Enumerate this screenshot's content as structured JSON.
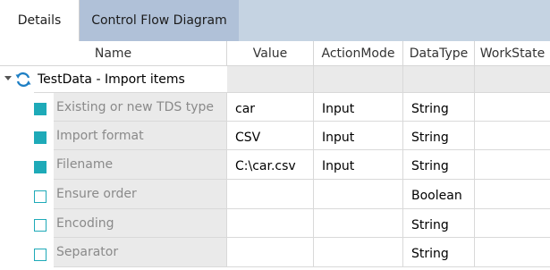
{
  "tabs": [
    {
      "label": "Details",
      "active": true
    },
    {
      "label": "Control Flow Diagram",
      "active": false
    }
  ],
  "columns": [
    "Name",
    "Value",
    "ActionMode",
    "DataType",
    "WorkState"
  ],
  "group": {
    "icon": "refresh-icon",
    "label": "TestData - Import items"
  },
  "rows": [
    {
      "checked": true,
      "name": "Existing or new TDS type",
      "value": "car",
      "action_mode": "Input",
      "data_type": "String",
      "work_state": ""
    },
    {
      "checked": true,
      "name": "Import format",
      "value": "CSV",
      "action_mode": "Input",
      "data_type": "String",
      "work_state": ""
    },
    {
      "checked": true,
      "name": "Filename",
      "value": "C:\\car.csv",
      "action_mode": "Input",
      "data_type": "String",
      "work_state": ""
    },
    {
      "checked": false,
      "name": "Ensure order",
      "value": "",
      "action_mode": "",
      "data_type": "Boolean",
      "work_state": ""
    },
    {
      "checked": false,
      "name": "Encoding",
      "value": "",
      "action_mode": "",
      "data_type": "String",
      "work_state": ""
    },
    {
      "checked": false,
      "name": "Separator",
      "value": "",
      "action_mode": "",
      "data_type": "String",
      "work_state": ""
    }
  ],
  "colors": {
    "accent": "#1eaab8",
    "tab_bar": "#c5d3e2",
    "tab_inactive": "#b0c1d8",
    "cell_gray": "#eaeaea"
  }
}
